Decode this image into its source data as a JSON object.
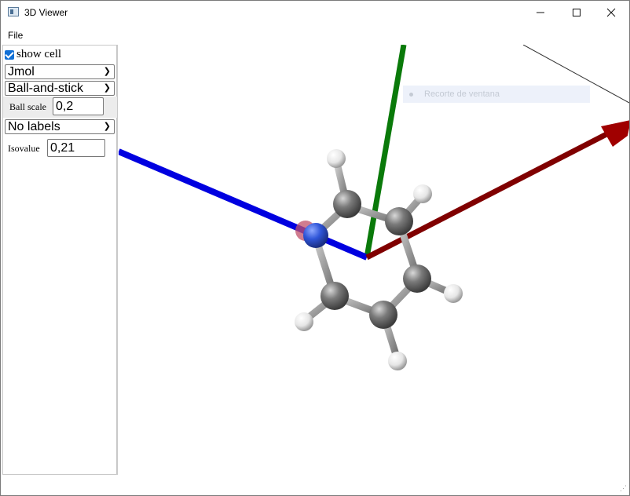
{
  "window": {
    "title": "3D Viewer",
    "min_icon": "minimize-icon",
    "max_icon": "maximize-icon",
    "close_icon": "close-icon"
  },
  "menu": {
    "file": "File"
  },
  "panel": {
    "show_cell": {
      "label": "show cell",
      "checked": true
    },
    "renderer": "Jmol",
    "style": "Ball-and-stick",
    "ball_scale_label": "Ball scale",
    "ball_scale_value": "0,2",
    "labels": "No labels",
    "isovalue_label": "Isovalue",
    "isovalue_value": "0,21"
  },
  "overlay": {
    "snip_hint": "Recorte de ventana"
  },
  "colors": {
    "axis_x": "#800000",
    "axis_y": "#0a7a0a",
    "axis_z": "#0000e0",
    "carbon": "#707070",
    "hydrogen": "#f0f0f0",
    "nitrogen": "#2f55d8"
  }
}
